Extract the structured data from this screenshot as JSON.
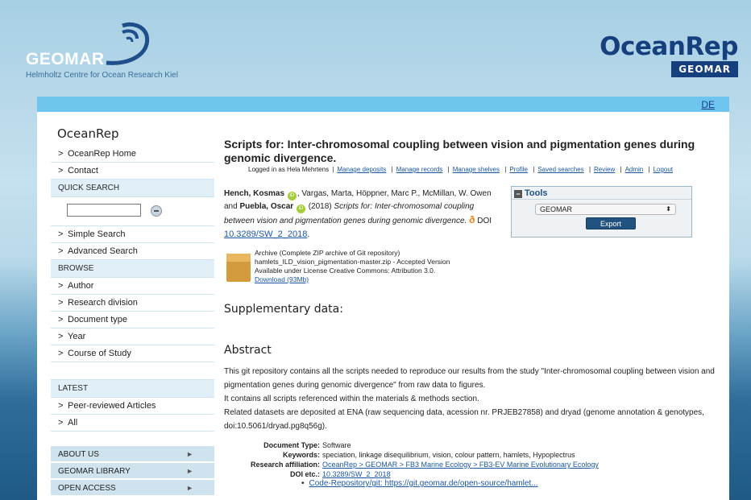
{
  "header": {
    "geomar_name": "GEOMAR",
    "geomar_subtitle": "Helmholtz Centre for Ocean Research Kiel",
    "oceanrep_word": "OceanRep",
    "oceanrep_badge": "GEOMAR",
    "lang_link": "DE"
  },
  "sidebar": {
    "title": "OceanRep",
    "top_items": [
      {
        "label": "OceanRep Home"
      },
      {
        "label": "Contact"
      }
    ],
    "quick_search_header": "QUICK SEARCH",
    "search_items": [
      {
        "label": "Simple Search"
      },
      {
        "label": "Advanced Search"
      }
    ],
    "browse_header": "BROWSE",
    "browse_items": [
      {
        "label": "Author"
      },
      {
        "label": "Research division"
      },
      {
        "label": "Document type"
      },
      {
        "label": "Year"
      },
      {
        "label": "Course of Study"
      }
    ],
    "latest_header": "LATEST",
    "latest_items": [
      {
        "label": "Peer-reviewed Articles"
      },
      {
        "label": "All"
      }
    ],
    "bottom_items": [
      {
        "label": "ABOUT US"
      },
      {
        "label": "GEOMAR LIBRARY"
      },
      {
        "label": "OPEN ACCESS"
      }
    ],
    "chevron": ">",
    "arrow": "►"
  },
  "main": {
    "title": "Scripts for: Inter-chromosomal coupling between vision and pigmentation genes during genomic divergence.",
    "logged_in": "Logged in as Hela Mehrtens",
    "user_links": [
      "Manage deposits",
      "Manage records",
      "Manage shelves",
      "Profile",
      "Saved searches",
      "Review",
      "Admin",
      "Logout"
    ],
    "citation": {
      "author1": "Hench, Kosmas",
      "authors_mid": ", Vargas, Marta, Höppner, Marc P., McMillan, W. Owen and ",
      "author_last": "Puebla, Oscar",
      "year": " (2018) ",
      "title_italic": "Scripts for: Inter-chromosomal coupling between vision and pigmentation genes during genomic divergence.",
      "doi_prefix": " DOI ",
      "doi": "10.3289/SW_2_2018",
      "orcid_glyph": "iD",
      "oa_glyph": "ð"
    },
    "tools": {
      "title": "Tools",
      "minus": "−",
      "select_value": "GEOMAR",
      "select_chevron": "⬍",
      "export_label": "Export"
    },
    "archive": {
      "line1": "Archive (Complete ZIP archive of Git repository)",
      "line2": "hamlets_ILD_vision_pigmentation-master.zip - Accepted Version",
      "line3": "Available under License Creative Commons: Attribution 3.0.",
      "download": "Download (93Mb)"
    },
    "supplementary_title": "Supplementary data:",
    "abstract_title": "Abstract",
    "abstract_lines": [
      "This git repository contains all the scripts needed to reproduce our results from the study \"Inter-chromosomal coupling between vision and pigmentation genes during genomic divergence\" from raw data to figures.",
      "It contains all scripts referenced within the materials & methods section.",
      "Related datasets are deposited at ENA (raw sequencing data, acession nr. PRJEB27858) and dryad (genome annotation & genotypes, doi:10.5061/dryad.pg8q56g)."
    ],
    "meta": {
      "doc_type_key": "Document Type:",
      "doc_type_val": "Software",
      "keywords_key": "Keywords:",
      "keywords_val": "speciation, linkage disequilibrium, vision, colour pattern, hamlets, Hypoplectrus",
      "affil_key": "Research affiliation:",
      "affil_val": "OceanRep > GEOMAR > FB3 Marine Ecology > FB3-EV Marine Evolutionary Ecology",
      "doi_key": "DOI etc.:",
      "doi_val": "10.3289/SW_2_2018",
      "code_repo": "Code-Repository/git: https://git.geomar.de/open-source/hamlet..."
    }
  }
}
